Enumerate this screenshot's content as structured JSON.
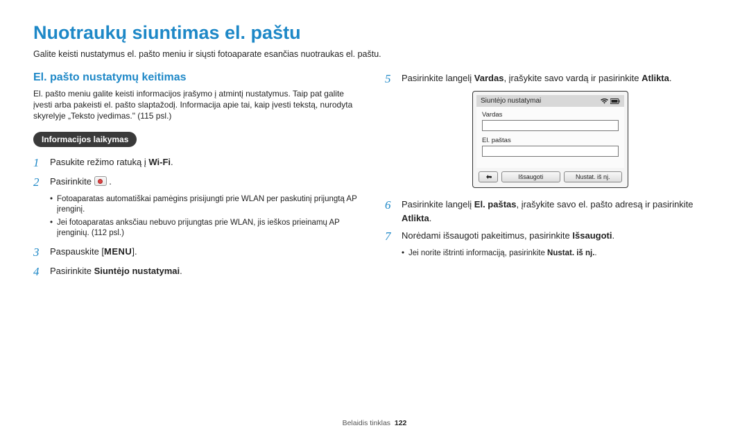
{
  "title": "Nuotraukų siuntimas el. paštu",
  "intro": "Galite keisti nustatymus el. pašto meniu ir siųsti fotoaparate esančias nuotraukas el. paštu.",
  "left": {
    "section_title": "El. pašto nustatymų keitimas",
    "section_desc": "El. pašto meniu galite keisti informacijos įrašymo į atmintį nustatymus. Taip pat galite įvesti arba pakeisti el. pašto slaptažodį. Informacija apie tai, kaip įvesti tekstą, nurodyta skyrelyje „Teksto įvedimas.\" (115 psl.)",
    "badge": "Informacijos laikymas",
    "step1_pre": "Pasukite režimo ratuką į ",
    "step1_wifi": "Wi-Fi",
    "step1_post": ".",
    "step2_pre": "Pasirinkite ",
    "step2_post": " .",
    "bullets2": [
      "Fotoaparatas automatiškai pamėgins prisijungti prie WLAN per paskutinį prijungtą AP įrenginį.",
      "Jei fotoaparatas anksčiau nebuvo prijungtas prie WLAN, jis ieškos prieinamų AP įrenginių. (112 psl.)"
    ],
    "step3_pre": "Paspauskite [",
    "step3_menu": "MENU",
    "step3_post": "].",
    "step4_pre": "Pasirinkite ",
    "step4_bold": "Siuntėjo nustatymai",
    "step4_post": "."
  },
  "right": {
    "step5_pre": "Pasirinkite langelį ",
    "step5_bold1": "Vardas",
    "step5_mid": ", įrašykite savo vardą ir pasirinkite ",
    "step5_bold2": "Atlikta",
    "step5_post": ".",
    "shot": {
      "header": "Siuntėjo nustatymai",
      "field1": "Vardas",
      "field2": "El. paštas",
      "btn_back": "↩",
      "btn_save": "Išsaugoti",
      "btn_reset": "Nustat. iš nj."
    },
    "step6_pre": "Pasirinkite langelį ",
    "step6_bold1": "El. paštas",
    "step6_mid": ", įrašykite savo el. pašto adresą ir pasirinkite ",
    "step6_bold2": "Atlikta",
    "step6_post": ".",
    "step7_pre": "Norėdami išsaugoti pakeitimus, pasirinkite ",
    "step7_bold": "Išsaugoti",
    "step7_post": ".",
    "bullets7_pre": "Jei norite ištrinti informaciją, pasirinkite ",
    "bullets7_bold": "Nustat. iš nj.",
    "bullets7_post": "."
  },
  "footer": {
    "section": "Belaidis tinklas",
    "page": "122"
  }
}
